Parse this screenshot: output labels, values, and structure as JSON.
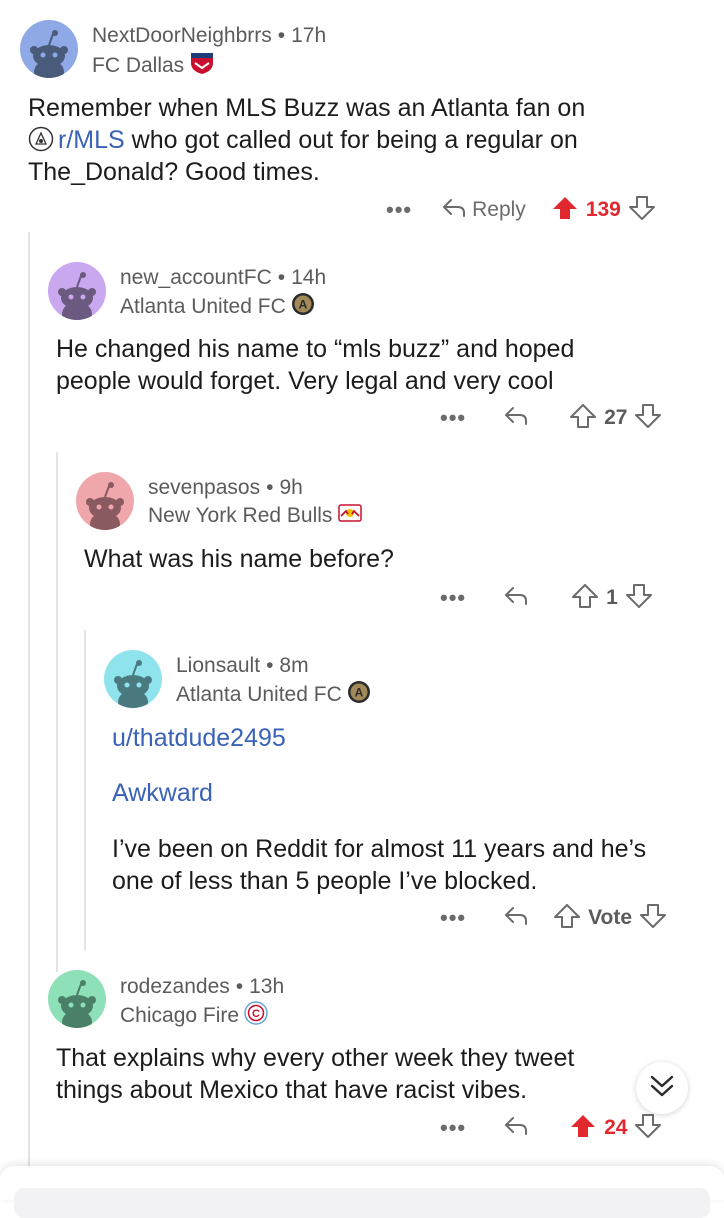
{
  "comments": [
    {
      "username": "NextDoorNeighbrrs",
      "time": "17h",
      "flair": "FC Dallas",
      "avatar_color": "#8ea9e6",
      "body_line1": "Remember when MLS Buzz was an Atlanta fan on",
      "body_link": "r/MLS",
      "body_line2_rest": " who got called out for being a regular on",
      "body_line3": "The_Donald? Good times.",
      "reply_label": "Reply",
      "score": "139",
      "upvoted": true
    },
    {
      "username": "new_accountFC",
      "time": "14h",
      "flair": "Atlanta United FC",
      "avatar_color": "#c9a8ef",
      "body_line1": "He changed his name to “mls buzz” and hoped",
      "body_line2": "people would forget. Very legal and very cool",
      "score": "27",
      "upvoted": false
    },
    {
      "username": "sevenpasos",
      "time": "9h",
      "flair": "New York Red Bulls",
      "avatar_color": "#f0a7ab",
      "body_line1": "What was his name before?",
      "score": "1",
      "upvoted": false
    },
    {
      "username": "Lionsault",
      "time": "8m",
      "flair": "Atlanta United FC",
      "avatar_color": "#8fe3ec",
      "link1": "u/thatdude2495",
      "link2": "Awkward",
      "body_line1": "I’ve been on Reddit for almost 11 years and he’s",
      "body_line2": "one of less than 5 people I’ve blocked.",
      "vote_label": "Vote",
      "upvoted": false
    },
    {
      "username": "rodezandes",
      "time": "13h",
      "flair": "Chicago Fire",
      "avatar_color": "#8de0b8",
      "body_line1": "That explains why every other week they tweet",
      "body_line2": "things about Mexico that have racist vibes.",
      "score": "24",
      "upvoted": true
    }
  ],
  "more_label": "•••",
  "dot": "•",
  "colors": {
    "upvote": "#e0282e",
    "link": "#3a62b6",
    "muted": "#5b5b5b"
  },
  "icons": {
    "reply": "reply-arrow-icon",
    "upvote": "upvote-arrow-icon",
    "downvote": "downvote-arrow-icon",
    "collapse": "chevron-double-down-icon"
  }
}
